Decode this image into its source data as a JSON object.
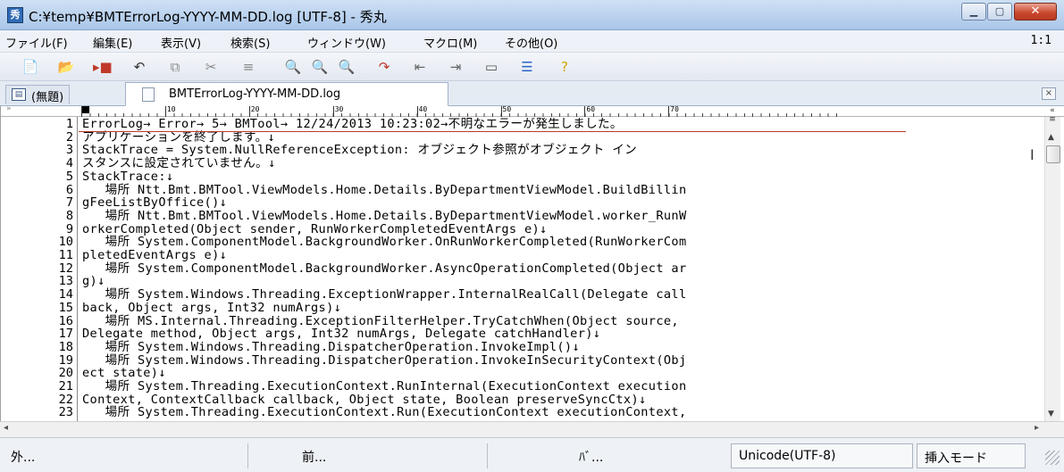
{
  "window": {
    "title": "C:¥temp¥BMTErrorLog-YYYY-MM-DD.log [UTF-8] - 秀丸",
    "app_icon": "hidemaru-icon",
    "controls": {
      "minimize": "▁",
      "maximize": "▢",
      "close": "✕"
    }
  },
  "menu": {
    "items": [
      "ファイル(F)",
      "編集(E)",
      "表示(V)",
      "検索(S)",
      "ウィンドウ(W)",
      "マクロ(M)",
      "その他(O)"
    ],
    "position": "1:1"
  },
  "toolbar": {
    "buttons": [
      {
        "icon": "new-file-icon",
        "glyph": "📄",
        "color": "#e9b949"
      },
      {
        "icon": "open-folder-icon",
        "glyph": "📂",
        "color": "#e0b000"
      },
      {
        "icon": "save-icon",
        "glyph": "▸■",
        "color": "#c0392b"
      },
      {
        "icon": "undo-icon",
        "glyph": "↶",
        "color": "#333333"
      },
      {
        "icon": "copy-icon",
        "glyph": "⧉",
        "color": "#8a8a8a"
      },
      {
        "icon": "cut-icon",
        "glyph": "✂",
        "color": "#8a8a8a"
      },
      {
        "icon": "paste-icon",
        "glyph": "≡",
        "color": "#8a8a8a"
      },
      {
        "icon": "search-icon",
        "glyph": "🔍",
        "color": "#2a64c8"
      },
      {
        "icon": "search-down-icon",
        "glyph": "🔍",
        "color": "#2a64c8"
      },
      {
        "icon": "search-up-icon",
        "glyph": "🔍",
        "color": "#2a64c8"
      },
      {
        "icon": "redo-icon",
        "glyph": "↷",
        "color": "#c0392b"
      },
      {
        "icon": "indent-left-icon",
        "glyph": "⇤",
        "color": "#666666"
      },
      {
        "icon": "indent-right-icon",
        "glyph": "⇥",
        "color": "#666666"
      },
      {
        "icon": "window-icon",
        "glyph": "▭",
        "color": "#555555"
      },
      {
        "icon": "split-icon",
        "glyph": "☰",
        "color": "#2a64c8"
      },
      {
        "icon": "help-icon",
        "glyph": "?",
        "color": "#d4a300"
      }
    ]
  },
  "tabs": {
    "untitled": "(無題)",
    "active": "BMTErrorLog-YYYY-MM-DD.log",
    "close": "×"
  },
  "ruler": {
    "cap": "»",
    "marks": [
      "0",
      "10",
      "20",
      "30",
      "40",
      "50",
      "60",
      "70"
    ]
  },
  "editor": {
    "lines": [
      {
        "n": "1",
        "text": "ErrorLog→ Error→ 5→ BMTool→ 12/24/2013 10:23:02→不明なエラーが発生しました。"
      },
      {
        "n": "2",
        "text": "アプリケーションを終了します。↓"
      },
      {
        "n": "3",
        "text": "StackTrace = System.NullReferenceException: オブジェクト参照がオブジェクト イン"
      },
      {
        "n": "4",
        "text": "スタンスに設定されていません。↓"
      },
      {
        "n": "5",
        "text": "StackTrace:↓"
      },
      {
        "n": "6",
        "text": "   場所 Ntt.Bmt.BMTool.ViewModels.Home.Details.ByDepartmentViewModel.BuildBillin"
      },
      {
        "n": "7",
        "text": "gFeeListByOffice()↓"
      },
      {
        "n": "8",
        "text": "   場所 Ntt.Bmt.BMTool.ViewModels.Home.Details.ByDepartmentViewModel.worker_RunW"
      },
      {
        "n": "9",
        "text": "orkerCompleted(Object sender, RunWorkerCompletedEventArgs e)↓"
      },
      {
        "n": "10",
        "text": "   場所 System.ComponentModel.BackgroundWorker.OnRunWorkerCompleted(RunWorkerCom"
      },
      {
        "n": "11",
        "text": "pletedEventArgs e)↓"
      },
      {
        "n": "12",
        "text": "   場所 System.ComponentModel.BackgroundWorker.AsyncOperationCompleted(Object ar"
      },
      {
        "n": "13",
        "text": "g)↓"
      },
      {
        "n": "14",
        "text": "   場所 System.Windows.Threading.ExceptionWrapper.InternalRealCall(Delegate call"
      },
      {
        "n": "15",
        "text": "back, Object args, Int32 numArgs)↓"
      },
      {
        "n": "16",
        "text": "   場所 MS.Internal.Threading.ExceptionFilterHelper.TryCatchWhen(Object source, "
      },
      {
        "n": "17",
        "text": "Delegate method, Object args, Int32 numArgs, Delegate catchHandler)↓"
      },
      {
        "n": "18",
        "text": "   場所 System.Windows.Threading.DispatcherOperation.InvokeImpl()↓"
      },
      {
        "n": "19",
        "text": "   場所 System.Windows.Threading.DispatcherOperation.InvokeInSecurityContext(Obj"
      },
      {
        "n": "20",
        "text": "ect state)↓"
      },
      {
        "n": "21",
        "text": "   場所 System.Threading.ExecutionContext.RunInternal(ExecutionContext execution"
      },
      {
        "n": "22",
        "text": "Context, ContextCallback callback, Object state, Boolean preserveSyncCtx)↓"
      },
      {
        "n": "23",
        "text": "   場所 System.Threading.ExecutionContext.Run(ExecutionContext executionContext,"
      }
    ]
  },
  "statusbar": {
    "cells": [
      "外...",
      "前...",
      "ﾊﾞ...",
      "Unicode(UTF-8)",
      "挿入モード"
    ]
  },
  "colors": {
    "cursor_line": "#c0392b",
    "titlebar": "#b9d1ee",
    "close_button": "#c8452b"
  }
}
